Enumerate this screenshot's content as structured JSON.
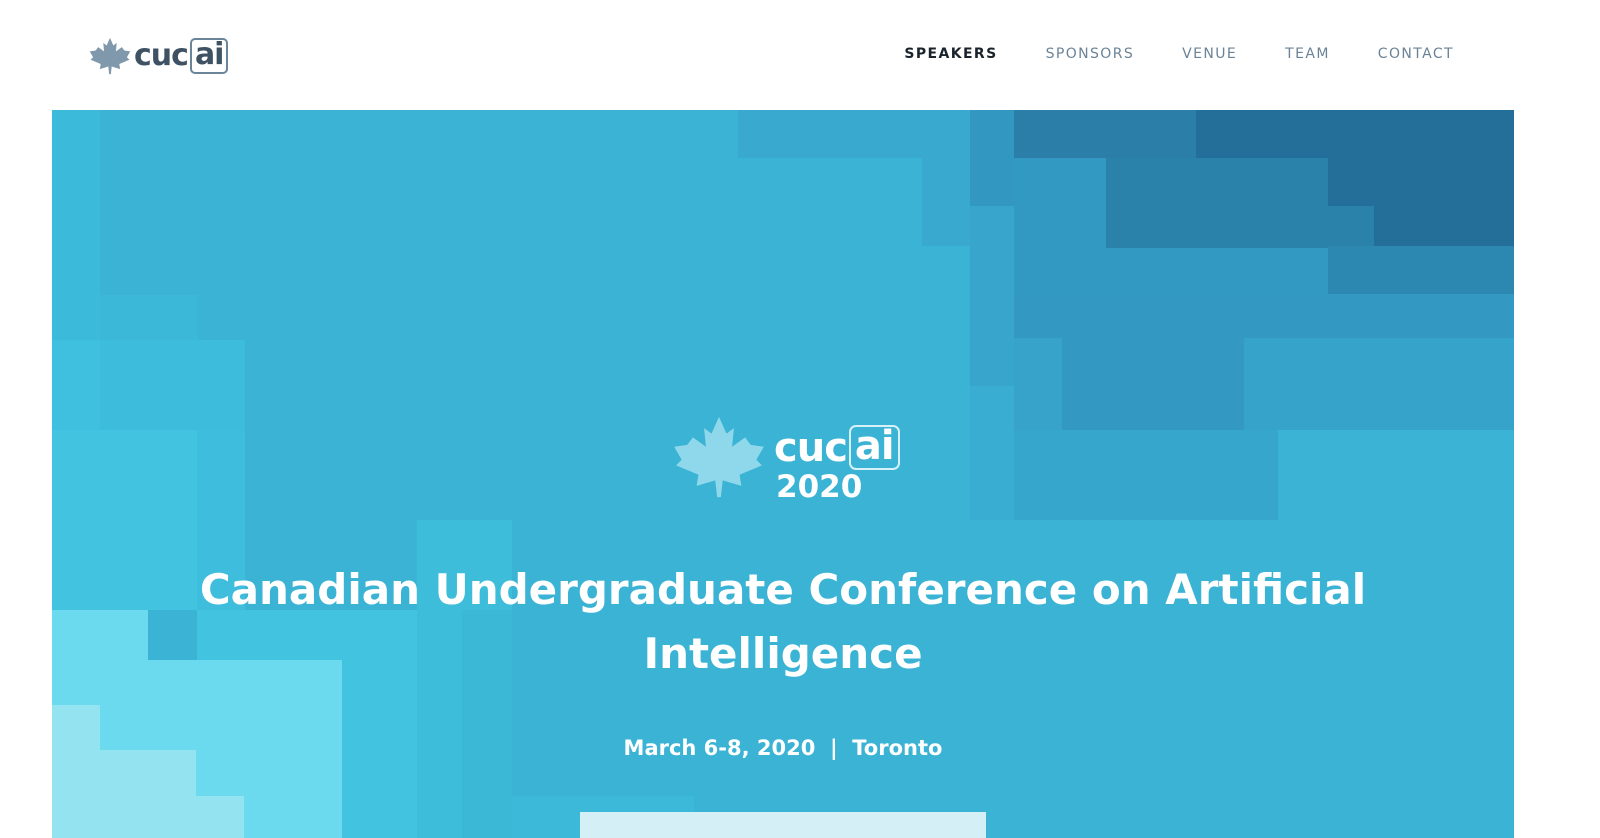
{
  "brand": {
    "name_prefix": "cuc",
    "name_box": "ai",
    "leaf_icon": "maple-leaf-icon",
    "logo_color": "#3f5264"
  },
  "nav": {
    "items": [
      {
        "label": "SPEAKERS",
        "active": true
      },
      {
        "label": "SPONSORS",
        "active": false
      },
      {
        "label": "VENUE",
        "active": false
      },
      {
        "label": "TEAM",
        "active": false
      },
      {
        "label": "CONTACT",
        "active": false
      }
    ]
  },
  "hero": {
    "logo_prefix": "cuc",
    "logo_box": "ai",
    "logo_year": "2020",
    "title": "Canadian Undergraduate Conference on Artificial Intelligence",
    "subtitle": "March 6-8, 2020  |  Toronto",
    "cta_label": "",
    "background_color": "#3ab3d5"
  }
}
